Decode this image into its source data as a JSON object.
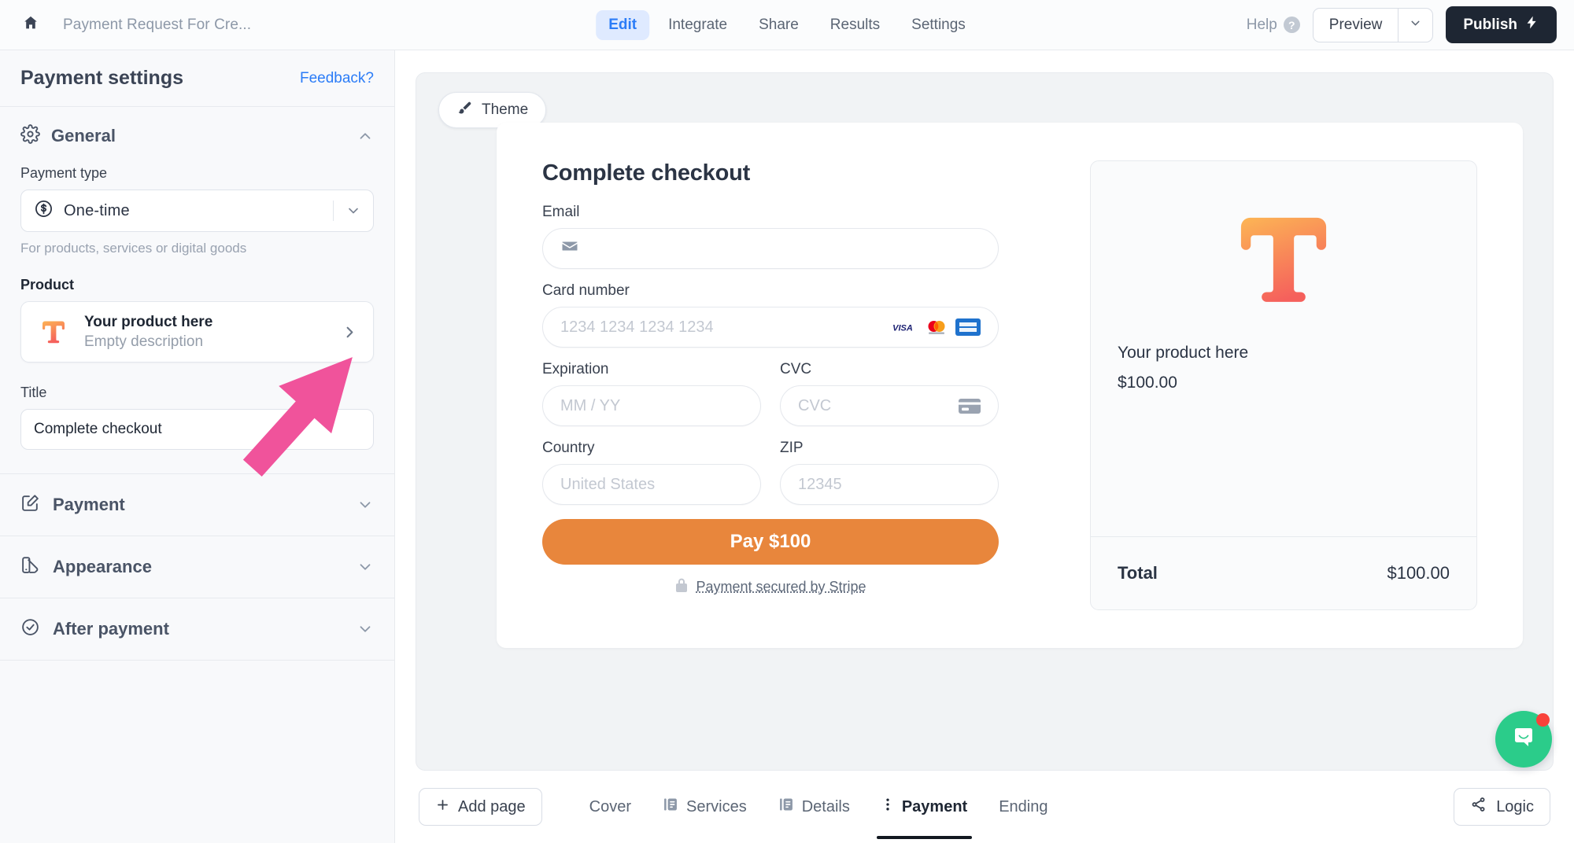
{
  "topbar": {
    "home_icon": "home-icon",
    "doc_title": "Payment Request For Cre...",
    "tabs": [
      {
        "label": "Edit",
        "active": true
      },
      {
        "label": "Integrate",
        "active": false
      },
      {
        "label": "Share",
        "active": false
      },
      {
        "label": "Results",
        "active": false
      },
      {
        "label": "Settings",
        "active": false
      }
    ],
    "help_label": "Help",
    "help_badge": "?",
    "preview_label": "Preview",
    "publish_label": "Publish"
  },
  "sidebar": {
    "title": "Payment settings",
    "feedback_label": "Feedback?",
    "general": {
      "section_label": "General",
      "payment_type_label": "Payment type",
      "payment_type_value": "One-time",
      "payment_type_helper": "For products, services or digital goods",
      "product_label": "Product",
      "product_name": "Your product here",
      "product_desc": "Empty description",
      "title_label": "Title",
      "title_value": "Complete checkout"
    },
    "collapsed_sections": [
      {
        "label": "Payment",
        "icon": "edit-square-icon"
      },
      {
        "label": "Appearance",
        "icon": "palette-icon"
      },
      {
        "label": "After payment",
        "icon": "check-circle-icon"
      }
    ]
  },
  "canvas": {
    "theme_button": "Theme",
    "checkout": {
      "title": "Complete checkout",
      "email_label": "Email",
      "email_value": "",
      "email_placeholder": "",
      "card_label": "Card number",
      "card_placeholder": "1234 1234 1234 1234",
      "card_brands": [
        "visa-icon",
        "mastercard-icon",
        "amex-icon"
      ],
      "expiration_label": "Expiration",
      "expiration_placeholder": "MM / YY",
      "cvc_label": "CVC",
      "cvc_placeholder": "CVC",
      "country_label": "Country",
      "country_placeholder": "United States",
      "zip_label": "ZIP",
      "zip_placeholder": "12345",
      "pay_button": "Pay $100",
      "secured_text": "Payment secured by Stripe"
    },
    "summary": {
      "product_name": "Your product here",
      "product_price": "$100.00",
      "total_label": "Total",
      "total_value": "$100.00"
    }
  },
  "bottombar": {
    "add_page_label": "Add page",
    "pages": [
      {
        "label": "Cover",
        "icon": "",
        "active": false
      },
      {
        "label": "Services",
        "icon": "page-icon",
        "active": false
      },
      {
        "label": "Details",
        "icon": "page-icon",
        "active": false
      },
      {
        "label": "Payment",
        "icon": "dots-vertical-icon",
        "active": true
      },
      {
        "label": "Ending",
        "icon": "",
        "active": false
      }
    ],
    "logic_label": "Logic"
  },
  "colors": {
    "accent_blue": "#2b7cf7",
    "publish_dark": "#1e2633",
    "pay_orange": "#e8863c",
    "logo_gradient_top": "#fcae54",
    "logo_gradient_bottom": "#f5645c",
    "chat_green": "#2bcc8a",
    "notification_red": "#f9423a",
    "cursor_pink": "#f0539b"
  }
}
